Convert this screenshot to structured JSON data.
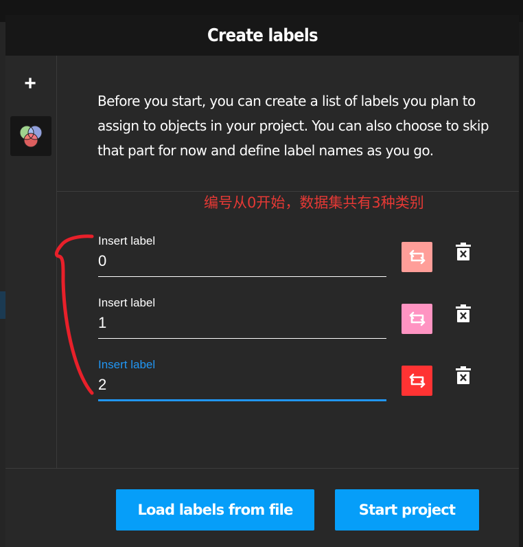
{
  "dialog": {
    "title": "Create labels"
  },
  "sidebar": {
    "add_glyph": "+",
    "add_icon": "plus-icon",
    "venn_icon": "venn-diagram-icon"
  },
  "description": "Before you start, you can create a list of labels you plan to assign to objects in your project. You can also choose to skip that part for now and define label names as you go.",
  "annotation": {
    "text": "编号从0开始，数据集共有3种类别",
    "color": "#e53935"
  },
  "labels": [
    {
      "caption": "Insert label",
      "value": "0",
      "color": "#ff9e99",
      "active": false
    },
    {
      "caption": "Insert label",
      "value": "1",
      "color": "#ff94c2",
      "active": false
    },
    {
      "caption": "Insert label",
      "value": "2",
      "color": "#ff3333",
      "active": true
    }
  ],
  "icons": {
    "color_change": "refresh-color-icon",
    "delete": "trash-icon"
  },
  "footer": {
    "load_button": "Load labels from file",
    "start_button": "Start project"
  },
  "colors": {
    "accent": "#069ef9",
    "focus": "#2196f3",
    "modal_bg": "#282828",
    "header_bg": "#171717"
  }
}
